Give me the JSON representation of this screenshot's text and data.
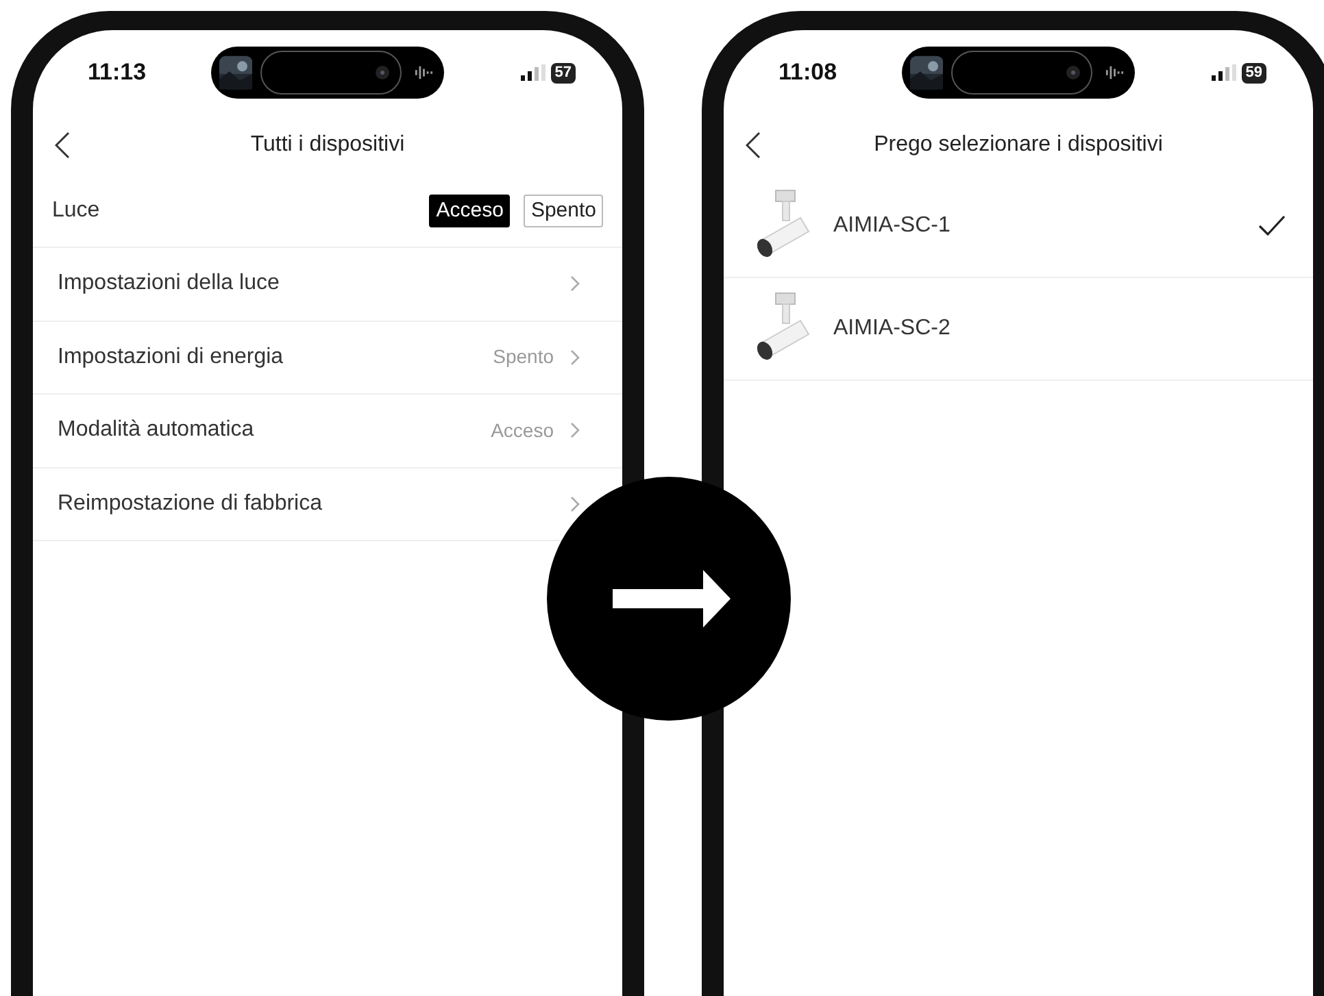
{
  "left_screen": {
    "status_bar": {
      "time": "11:13",
      "battery": "57"
    },
    "header": {
      "title": "Tutti i dispositivi"
    },
    "toggle": {
      "label": "Luce",
      "options": [
        {
          "label": "Acceso",
          "selected": true
        },
        {
          "label": "Spento",
          "selected": false
        }
      ]
    },
    "settings": [
      {
        "label": "Impostazioni della luce"
      },
      {
        "label": "Impostazioni di energia",
        "value": "Spento"
      },
      {
        "label": "Modalità automatica",
        "value": "Acceso"
      },
      {
        "label": "Reimpostazione di fabbrica"
      }
    ]
  },
  "right_screen": {
    "status_bar": {
      "time": "11:08",
      "battery": "59"
    },
    "header": {
      "title": "Prego selezionare i dispositivi"
    },
    "devices": [
      {
        "name": "AIMIA-SC-1",
        "selected": true
      },
      {
        "name": "AIMIA-SC-2",
        "selected": false
      }
    ]
  }
}
